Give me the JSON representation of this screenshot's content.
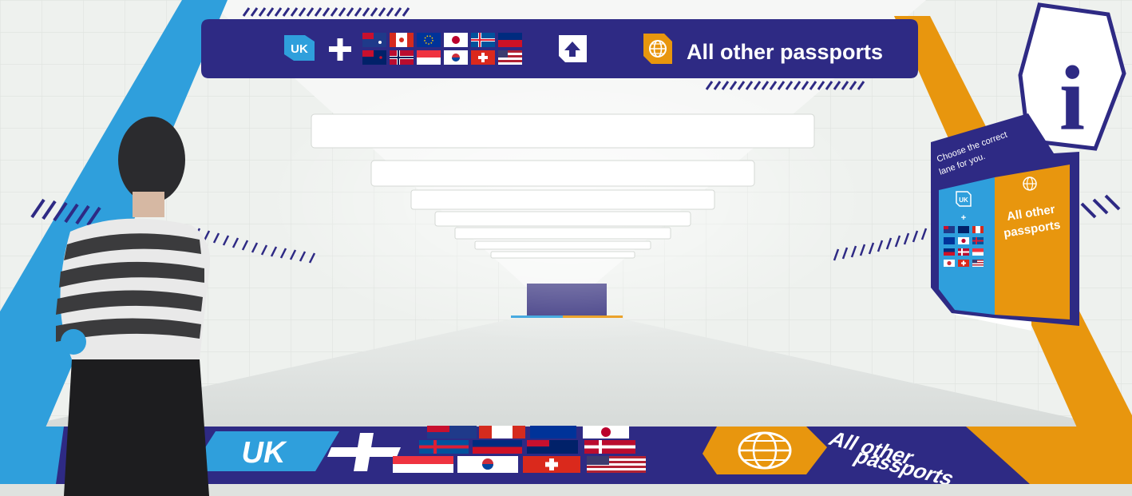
{
  "signage": {
    "uk_badge": "UK",
    "all_other_passports": "All other passports",
    "info_letter": "i",
    "board_instruction_line1": "Choose the correct",
    "board_instruction_line2": "lane for you.",
    "board_uk_badge": "UK",
    "board_all_other_line1": "All other",
    "board_all_other_line2": "passports",
    "floor_uk_badge": "UK",
    "floor_all_other_line1": "All other",
    "floor_all_other_line2": "passports"
  },
  "icons": {
    "up_arrow": "up-arrow-icon",
    "globe": "globe-icon",
    "info": "info-icon",
    "plus": "plus-icon"
  },
  "flags": [
    "australia",
    "canada",
    "european-union",
    "japan",
    "iceland",
    "liechtenstein",
    "new-zealand",
    "norway",
    "singapore",
    "south-korea",
    "switzerland",
    "united-states"
  ],
  "colors": {
    "navy": "#2e2a84",
    "sky_blue": "#2f9fdc",
    "orange": "#e8960e",
    "white": "#ffffff"
  }
}
